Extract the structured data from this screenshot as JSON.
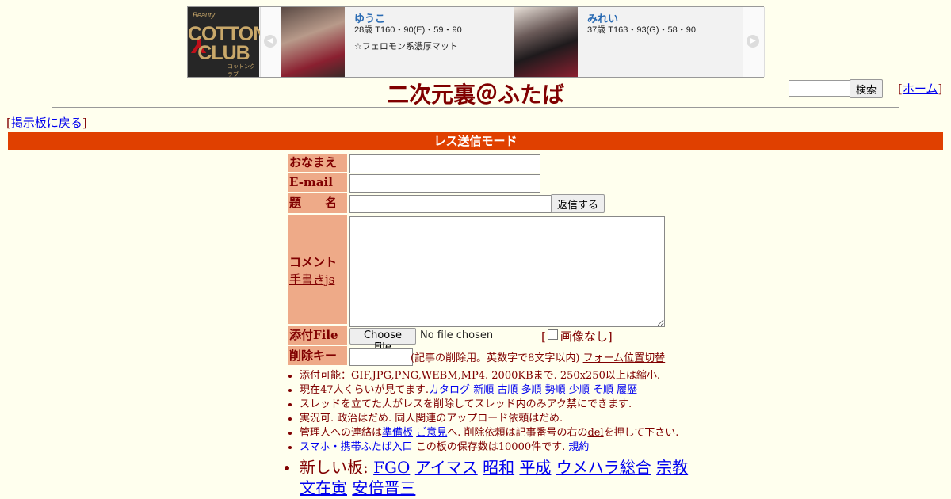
{
  "ad": {
    "logo_line1": "Beauty",
    "logo_line2": "COTTON CLUB",
    "logo_line3": "コットンクラブ",
    "left_arrow": "◀",
    "right_arrow": "▶",
    "cards": [
      {
        "name": "ゆうこ",
        "stats": "28歳 T160・90(E)・59・90",
        "desc": "☆フェロモン系濃厚マット"
      },
      {
        "name": "みれい",
        "stats": "37歳 T163・93(G)・58・90",
        "desc": ""
      }
    ]
  },
  "header": {
    "title": "二次元裏＠ふたば",
    "search_button": "検索",
    "home_open": "[",
    "home_link": "ホーム",
    "home_close": "]"
  },
  "nav": {
    "back_open": "[",
    "back_link": "掲示板に戻る",
    "back_close": "]"
  },
  "form": {
    "mode_title": "レス送信モード",
    "name_label": "おなまえ",
    "email_label": "E-mail",
    "subject_label": "題　　名",
    "reply_button": "返信する",
    "comment_label": "コメント",
    "handwriting_link": "手書きjs",
    "file_label": "添付File",
    "file_button": "Choose File",
    "file_status": "No file chosen",
    "noimage_open": "[",
    "noimage_label": "画像なし",
    "noimage_close": "]",
    "delkey_label": "削除キー",
    "delkey_note": "(記事の削除用。英数字で8文字以内)",
    "form_toggle_link": "フォーム位置切替"
  },
  "notes": {
    "n1": "添付可能：GIF,JPG,PNG,WEBM,MP4. 2000KBまで. 250x250以上は縮小.",
    "n2_prefix": "現在47人くらいが見てます.",
    "n2_links": [
      "カタログ",
      "新順",
      "古順",
      "多順",
      "勢順",
      "少順",
      "そ順",
      "履歴"
    ],
    "n3": "スレッドを立てた人がレスを削除してスレッド内のみアク禁にできます.",
    "n4": "実況可. 政治はだめ. 同人関連のアップロード依頼はだめ.",
    "n5_a": "管理人への連絡は",
    "n5_link1": "準備板",
    "n5_link2": "ご意見",
    "n5_b": "へ. 削除依頼は記事番号の右の",
    "n5_del": "del",
    "n5_c": "を押して下さい.",
    "n6_link": "スマホ・携帯ふたば入口",
    "n6_text": " この板の保存数は10000件です.",
    "n6_link2": "規約",
    "n7_prefix": "新しい板: ",
    "n7_links": [
      "FGO",
      "アイマス",
      "昭和",
      "平成",
      "ウメハラ総合",
      "宗教",
      "文在寅",
      "安倍晋三"
    ]
  }
}
